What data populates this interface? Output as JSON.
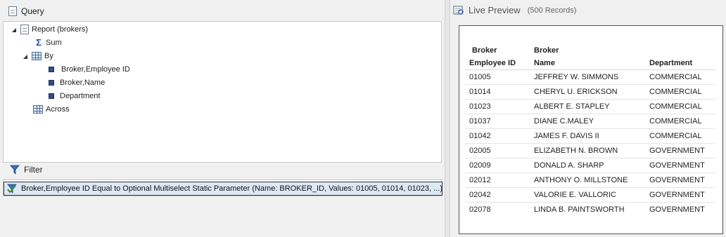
{
  "query": {
    "title": "Query",
    "report_label": "Report (brokers)",
    "sum_label": "Sum",
    "by_label": "By",
    "by_fields": [
      "Broker,Employee ID",
      "Broker,Name",
      "Department"
    ],
    "across_label": "Across"
  },
  "filter": {
    "title": "Filter",
    "item": "Broker,Employee ID Equal to Optional Multiselect Static Parameter (Name: BROKER_ID, Values: 01005, 01014, 01023, ...)"
  },
  "preview": {
    "title": "Live Preview",
    "records": "(500 Records)",
    "headers": {
      "id_line1": "Broker",
      "id_line2": "Employee ID",
      "name_line1": "Broker",
      "name_line2": "Name",
      "dept": "Department"
    },
    "rows": [
      [
        "01005",
        "JEFFREY W. SIMMONS",
        "COMMERCIAL"
      ],
      [
        "01014",
        "CHERYL U. ERICKSON",
        "COMMERCIAL"
      ],
      [
        "01023",
        "ALBERT E. STAPLEY",
        "COMMERCIAL"
      ],
      [
        "01037",
        "DIANE C.MALEY",
        "COMMERCIAL"
      ],
      [
        "01042",
        "JAMES F. DAVIS II",
        "COMMERCIAL"
      ],
      [
        "02005",
        "ELIZABETH N. BROWN",
        "GOVERNMENT"
      ],
      [
        "02009",
        "DONALD A. SHARP",
        "GOVERNMENT"
      ],
      [
        "02012",
        "ANTHONY O. MILLSTONE",
        "GOVERNMENT"
      ],
      [
        "02042",
        "VALORIE E. VALLORIC",
        "GOVERNMENT"
      ],
      [
        "02078",
        "LINDA B. PAINTSWORTH",
        "GOVERNMENT"
      ]
    ]
  }
}
